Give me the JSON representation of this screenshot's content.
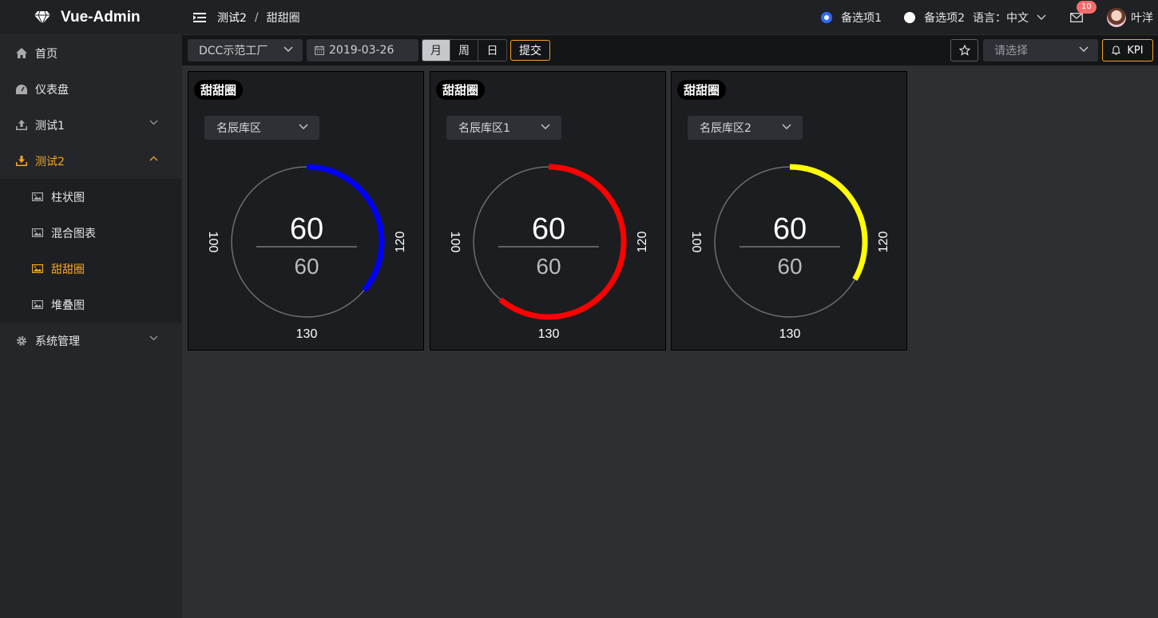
{
  "app": {
    "title": "Vue-Admin"
  },
  "breadcrumb": {
    "parent": "测试2",
    "separator": "/",
    "current": "甜甜圈"
  },
  "header": {
    "radio1": "备选项1",
    "radio2": "备选项2",
    "language": "语言：中文",
    "mail_badge": "10",
    "username": "叶洋"
  },
  "sidebar": {
    "items": [
      {
        "label": "首页",
        "icon": "home-icon"
      },
      {
        "label": "仪表盘",
        "icon": "dashboard-icon"
      },
      {
        "label": "测试1",
        "icon": "upload-icon"
      },
      {
        "label": "测试2",
        "icon": "download-icon",
        "active": true
      },
      {
        "label": "系统管理",
        "icon": "gear-icon"
      }
    ],
    "submenu": [
      {
        "label": "柱状图",
        "icon": "image-icon"
      },
      {
        "label": "混合图表",
        "icon": "image-icon"
      },
      {
        "label": "甜甜圈",
        "icon": "image-icon",
        "active": true
      },
      {
        "label": "堆叠图",
        "icon": "image-icon"
      }
    ]
  },
  "toolbar": {
    "factory": "DCC示范工厂",
    "date": "2019-03-26",
    "segments": [
      "月",
      "周",
      "日"
    ],
    "active_segment": "月",
    "submit": "提交",
    "select_placeholder": "请选择",
    "kpi": "KPI"
  },
  "colors": {
    "accent": "#f5a623",
    "blue": "#0000ff",
    "red": "#ff0000",
    "yellow": "#ffff00"
  },
  "cards": [
    {
      "title": "甜甜圈",
      "select": "名辰库区",
      "value_top": "60",
      "value_bottom": "60",
      "label_left": "100",
      "label_right": "120",
      "label_bottom": "130",
      "color": "#0000ff",
      "arc_start_deg": 0,
      "arc_end_deg": 130
    },
    {
      "title": "甜甜圈",
      "select": "名辰库区1",
      "value_top": "60",
      "value_bottom": "60",
      "label_left": "100",
      "label_right": "120",
      "label_bottom": "130",
      "color": "#ff0000",
      "arc_start_deg": 0,
      "arc_end_deg": 220
    },
    {
      "title": "甜甜圈",
      "select": "名辰库区2",
      "value_top": "60",
      "value_bottom": "60",
      "label_left": "100",
      "label_right": "120",
      "label_bottom": "130",
      "color": "#ffff00",
      "arc_start_deg": 0,
      "arc_end_deg": 120
    }
  ]
}
